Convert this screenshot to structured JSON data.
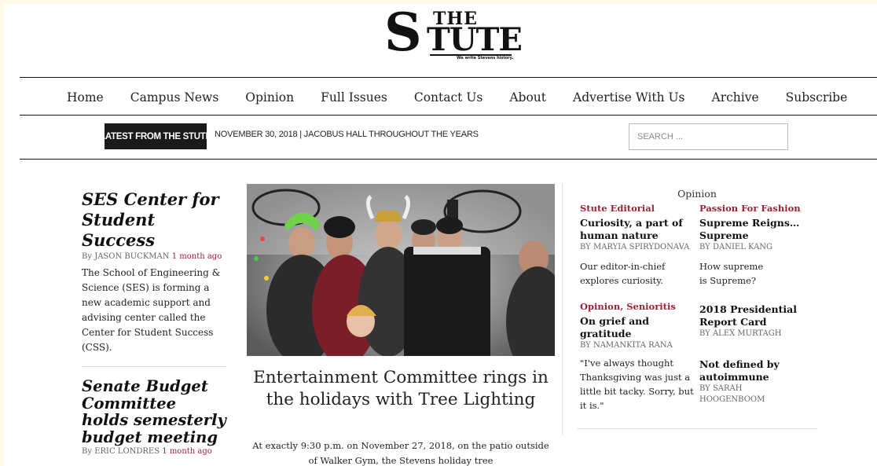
{
  "logo": {
    "s": "S",
    "the": "THE",
    "tute": "TUTE",
    "tagline": "We write Stevens history."
  },
  "nav": [
    "Home",
    "Campus News",
    "Opinion",
    "Full Issues",
    "Contact Us",
    "About",
    "Advertise With Us",
    "Archive",
    "Subscribe"
  ],
  "ticker": {
    "label": "LATEST FROM THE STUTE",
    "text": "NOVEMBER 30, 2018  |  JACOBUS HALL THROUGHOUT THE YEARS"
  },
  "search": {
    "placeholder": "SEARCH ..."
  },
  "left_stories": [
    {
      "title": "SES Center for Student Success",
      "by": "By",
      "author": "JASON BUCKMAN",
      "ago": "1 month ago",
      "excerpt": "The School of Engineering & Science (SES) is forming a new academic support and advising center called the Center for Student Success (CSS)."
    },
    {
      "title": "Senate Budget Committee holds semesterly budget meeting",
      "by": "By",
      "author": "ERIC LONDRES",
      "ago": "1 month ago"
    }
  ],
  "featured": {
    "title": "Entertainment Committee rings in the holidays with Tree Lighting",
    "excerpt": "At exactly 9:30 p.m. on November 27, 2018, on the patio outside of Walker Gym, the Stevens holiday tree"
  },
  "opinion": {
    "heading": "Opinion",
    "items": [
      {
        "category": "Stute Editorial",
        "title": "Curiosity, a part of human nature",
        "byline": "By MARYIA SPIRYDONAVA",
        "excerpt": "Our editor-in-chief explores curiosity."
      },
      {
        "category": "Passion For Fashion",
        "title": "Supreme Reigns… Supreme",
        "byline": "By DANIEL KANG",
        "excerpt": "How supreme is Supreme?"
      },
      {
        "category": "Opinion, Senioritis",
        "title": "On grief and gratitude",
        "byline": "By NAMANKITA RANA",
        "excerpt": "\"I've always thought Thanksgiving was just a little bit tacky. Sorry, but it is.\""
      },
      {
        "category": "",
        "title": "2018 Presidential Report Card",
        "byline": "By ALEX MURTAGH",
        "excerpt": ""
      },
      {
        "category": "",
        "title": "Not defined by autoimmune",
        "byline": "By SARAH HOOGENBOOM",
        "excerpt": ""
      }
    ]
  },
  "colors": {
    "accent": "#9b2335",
    "ticker_bg": "#1a1a1a",
    "page_bg": "#fff9e6"
  }
}
